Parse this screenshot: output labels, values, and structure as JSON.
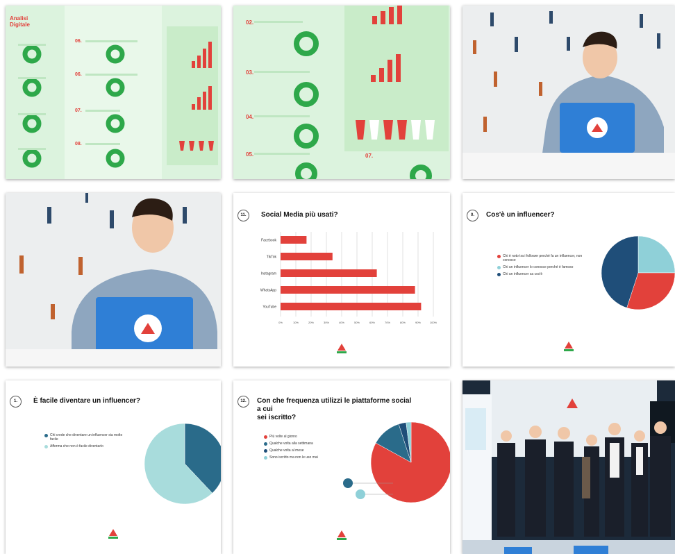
{
  "colors": {
    "green_bg": "#dff5e0",
    "green_ring": "#2ea84a",
    "red": "#e2413b",
    "navy": "#1f4e79",
    "light_blue": "#8fd0d8",
    "teal": "#2a6b8a",
    "pale_teal": "#a8dcdc",
    "laptop_blue": "#2f7fd6"
  },
  "infographic_left": {
    "title_line1": "Analisi",
    "title_line2": "Digitale",
    "items": [
      {
        "num": "06."
      },
      {
        "num": "06."
      },
      {
        "num": "07."
      },
      {
        "num": "08."
      }
    ]
  },
  "infographic_mid": {
    "items": [
      {
        "num": "02."
      },
      {
        "num": "03."
      },
      {
        "num": "04."
      },
      {
        "num": "05."
      },
      {
        "num": "07."
      }
    ]
  },
  "social_slide": {
    "num": "11.",
    "title": "Social Media più usati?",
    "chart_data": {
      "type": "bar",
      "orientation": "horizontal",
      "categories": [
        "Facebook",
        "TikTok",
        "Instagram",
        "WhatsApp",
        "YouTube"
      ],
      "values": [
        17,
        34,
        63,
        88,
        92
      ],
      "xlim": [
        0,
        100
      ],
      "ticks": [
        "0%",
        "10%",
        "20%",
        "30%",
        "40%",
        "50%",
        "60%",
        "70%",
        "80%",
        "90%",
        "100%"
      ],
      "color": "#e2413b"
    }
  },
  "influencer_slide": {
    "num": "0.",
    "title": "Cos'è un influencer?",
    "legend": [
      "Chi è noto tra i follower perché fa un influencer, non conosce",
      "Chi un influencer lo conosce perché è famoso",
      "Chi un influencer sa cos'è"
    ],
    "chart_data": {
      "type": "pie",
      "slices": [
        {
          "value": 25,
          "color": "#8fd0d8"
        },
        {
          "value": 30,
          "color": "#e2413b"
        },
        {
          "value": 45,
          "color": "#1f4e79"
        }
      ]
    }
  },
  "facile_slide": {
    "num": "1.",
    "title": "È facile diventare un influencer?",
    "legend": [
      "Chi crede che diventare un influencer sia molto facile",
      "Afferma che non è facile diventarlo"
    ],
    "chart_data": {
      "type": "pie",
      "slices": [
        {
          "value": 38,
          "color": "#2a6b8a"
        },
        {
          "value": 62,
          "color": "#a8dcdc"
        }
      ]
    }
  },
  "frequenza_slide": {
    "num": "12.",
    "title_line1": "Con che frequenza utilizzi le piattaforme social a cui",
    "title_line2": "sei iscritto?",
    "legend": [
      "Più volte al giorno",
      "Qualche volta alla settimana",
      "Qualche volta al mese",
      "Sono iscritto ma non le uso mai"
    ],
    "chart_data": {
      "type": "pie",
      "slices": [
        {
          "value": 83,
          "color": "#e2413b"
        },
        {
          "value": 12,
          "color": "#2a6b8a"
        },
        {
          "value": 3,
          "color": "#1f4e79"
        },
        {
          "value": 2,
          "color": "#8fd0d8"
        }
      ]
    }
  }
}
